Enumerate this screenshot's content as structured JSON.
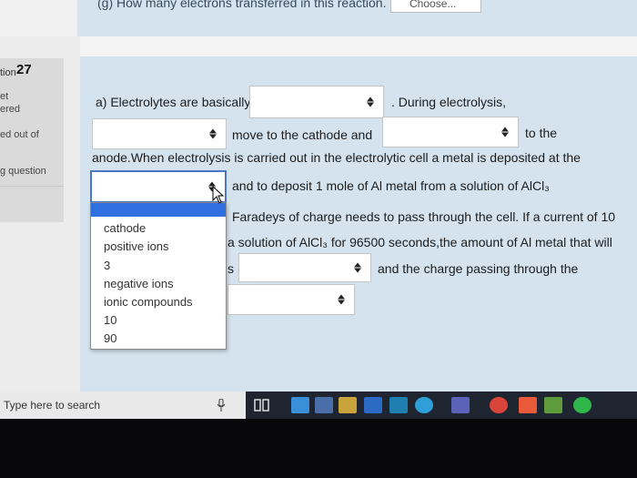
{
  "top": {
    "question_text": "(g) How many electrons transferred in this reaction.",
    "select_value": "Choose..."
  },
  "sidebar": {
    "question_label": "tion",
    "question_number": "27",
    "status_1": "et",
    "status_2": "ered",
    "marks": "ed out of",
    "flag": "g question"
  },
  "question": {
    "line1_a": "a) Electrolytes are basically",
    "line1_b": ". During electrolysis,",
    "line2_a": "move to the cathode and",
    "line2_b": "to the",
    "line3": "anode.When electrolysis is carried out in the electrolytic cell a metal is deposited at the",
    "line4": "and to deposit 1 mole of Al metal from a solution of AlCl₃",
    "line5": "Faradeys of charge needs to pass through the cell. If a current of 10",
    "line6": "a solution of AlCl₃ for 96500 seconds,the amount of Al metal that will",
    "line7_prefix": "s",
    "line7_b": "and the charge passing through the"
  },
  "dropdown": {
    "options": [
      "cathode",
      "positive ions",
      "3",
      "negative ions",
      "ionic compounds",
      "10",
      "90"
    ]
  },
  "taskbar": {
    "search_placeholder": "Type here to search"
  },
  "colors": {
    "question_bg": "#d4e3ee",
    "select_highlight": "#2f6fe0",
    "taskbar": "#1e2530"
  }
}
